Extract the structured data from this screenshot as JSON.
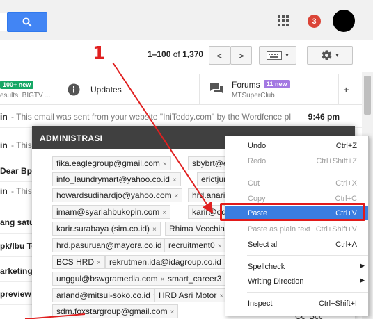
{
  "header": {
    "notifications": "3"
  },
  "toolbar": {
    "pager_range": "1–100",
    "pager_of": "of",
    "pager_total": "1,370",
    "prev": "<",
    "next": ">",
    "settings_caret": "▾",
    "keyboard_caret": "▾"
  },
  "tabs": {
    "primary_badge": "100+ new",
    "primary_snippet": "esults, BIGTV ...",
    "updates_label": "Updates",
    "forums_label": "Forums",
    "forums_badge": "11 new",
    "forums_sub": "MTSuperClub",
    "add": "+"
  },
  "emails": [
    {
      "sender": "in",
      "snippet": " - This email was sent from your website \"IniTeddy.com\" by the Wordfence pl",
      "time": "9:46 pm"
    },
    {
      "sender": "in",
      "snippet": " - This",
      "time": ""
    },
    {
      "sender": "Dear Bp",
      "snippet": "",
      "time": ""
    },
    {
      "sender": "in",
      "snippet": " - This",
      "time": ""
    },
    {
      "sender": "ang satu",
      "snippet": "",
      "time": ""
    },
    {
      "sender": "pk/Ibu Te",
      "snippet": "",
      "time": ""
    },
    {
      "sender": "arketing A",
      "snippet": "",
      "time": ""
    },
    {
      "sender": "preview s",
      "snippet": "",
      "time": ""
    }
  ],
  "compose": {
    "title": "ADMINISTRASI",
    "chips": [
      "fika.eaglegroup@gmail.com",
      "sbybrt@erob",
      "info_laundrymart@yahoo.co.id",
      "erictjung@",
      "howardsudihardjo@yahoo.com",
      "hrd.anarial",
      "imam@syariahbukopin.com",
      "karir@ode.c",
      "karir.surabaya (sim.co.id)",
      "Rhima Vecchia",
      "hrd.pasuruan@mayora.co.id",
      "recruitment0",
      "BCS HRD",
      "rekrutmen.ida@idagroup.co.id",
      "unggul@bswgramedia.com",
      "smart_career3",
      "arland@mitsui-soko.co.id",
      "HRD Asri Motor",
      "sdm.foxstargroup@gmail.com"
    ],
    "chip_close": "×",
    "cc": "Cc",
    "bcc": "Bcc"
  },
  "context_menu": {
    "undo": {
      "label": "Undo",
      "shortcut": "Ctrl+Z"
    },
    "redo": {
      "label": "Redo",
      "shortcut": "Ctrl+Shift+Z"
    },
    "cut": {
      "label": "Cut",
      "shortcut": "Ctrl+X"
    },
    "copy": {
      "label": "Copy",
      "shortcut": "Ctrl+C"
    },
    "paste": {
      "label": "Paste",
      "shortcut": "Ctrl+V"
    },
    "paste_plain": {
      "label": "Paste as plain text",
      "shortcut": "Ctrl+Shift+V"
    },
    "select_all": {
      "label": "Select all",
      "shortcut": "Ctrl+A"
    },
    "spellcheck": {
      "label": "Spellcheck"
    },
    "writing_direction": {
      "label": "Writing Direction"
    },
    "inspect": {
      "label": "Inspect",
      "shortcut": "Ctrl+Shift+I"
    }
  },
  "annotation": {
    "number": "1"
  },
  "colors": {
    "accent": "#4285f4",
    "highlight": "#3b7de0",
    "annotation": "#e02020",
    "badge_green": "#16a765",
    "badge_purple": "#a479e2",
    "badge_red": "#db4437"
  }
}
